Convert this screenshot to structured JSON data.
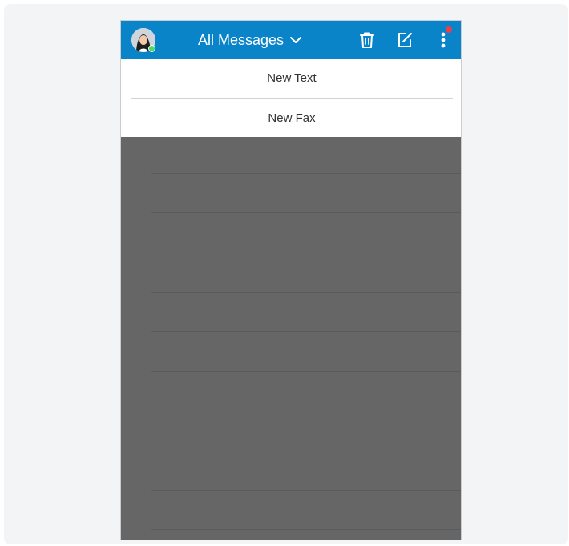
{
  "header": {
    "title": "All Messages",
    "icons": {
      "avatar": "user-avatar",
      "dropdown": "chevron-down-icon",
      "delete": "trash-icon",
      "compose": "compose-icon",
      "more": "more-vertical-icon"
    },
    "colors": {
      "bar": "#0a84c8",
      "presence": "#4cd964",
      "notification": "#e8414a"
    }
  },
  "new_menu": {
    "items": [
      {
        "label": "New Text"
      },
      {
        "label": "New Fax"
      }
    ]
  },
  "overlay": {
    "color": "#666666"
  }
}
